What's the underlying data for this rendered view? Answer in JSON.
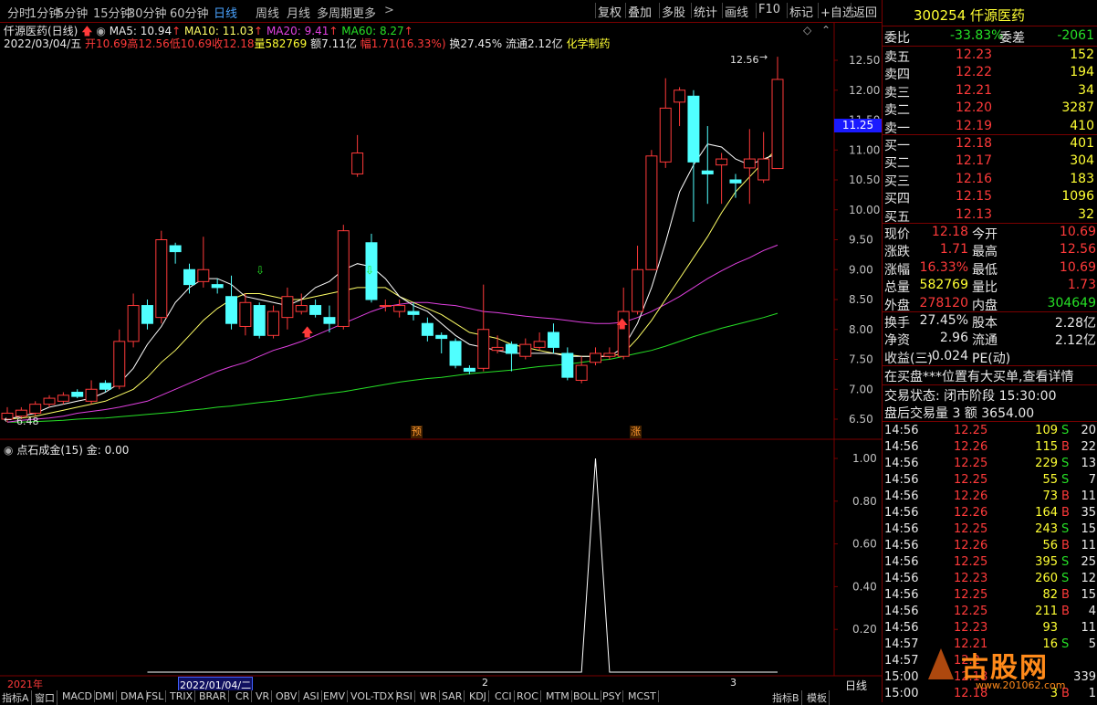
{
  "toolbar": {
    "periods": [
      "分时",
      "1分钟",
      "5分钟",
      "15分钟",
      "30分钟",
      "60分钟",
      "日线",
      "周线",
      "月线",
      "多周期",
      "更多"
    ],
    "active_period": "日线",
    "actions": [
      "复权",
      "叠加",
      "多股",
      "统计",
      "画线",
      "F10",
      "标记",
      "+自选",
      "返回"
    ]
  },
  "stock_line": {
    "name": "仟源医药(日线)",
    "ma5": "MA5: 10.94",
    "ma10": "MA10: 11.03",
    "ma20": "MA20: 9.41",
    "ma60": "MA60: 8.27",
    "date": "2022/03/04/五",
    "open": "开10.69",
    "high": "高12.56",
    "low": "低10.69",
    "close": "收12.18",
    "volume": "量582769",
    "amount": "额7.11亿",
    "range": "幅1.71(16.33%)",
    "turnover": "换27.45%",
    "float": "流通2.12亿",
    "industry": "化学制药"
  },
  "colors": {
    "up": "#ff3a3a",
    "down": "#50ffff",
    "ma5": "#ffffff",
    "ma10": "#ffff66",
    "ma20": "#e040e0",
    "ma60": "#26e026",
    "grid_border": "#7a0000"
  },
  "price_axis": {
    "labels": [
      "12.50",
      "12.00",
      "11.50",
      "11.00",
      "10.50",
      "10.00",
      "9.50",
      "9.00",
      "8.50",
      "8.00",
      "7.50",
      "7.00",
      "6.50"
    ],
    "current": "11.25",
    "high_mark": "12.56",
    "low_mark": "6.48"
  },
  "markers": {
    "yu": "预",
    "zhang": "涨"
  },
  "indicator": {
    "title": "点石成金(15)",
    "value": "金: 0.00",
    "labels": [
      "1.00",
      "0.80",
      "0.60",
      "0.40",
      "0.20"
    ],
    "axis_label": "日线"
  },
  "x_axis": {
    "labels": [
      "2021年",
      "2022/01/04/二",
      "2",
      "3"
    ]
  },
  "bottom_tabs": [
    "指标A",
    "窗口",
    "MACD",
    "DMI",
    "DMA",
    "FSL",
    "TRIX",
    "BRAR",
    "CR",
    "VR",
    "OBV",
    "ASI",
    "EMV",
    "VOL-TDX",
    "RSI",
    "WR",
    "SAR",
    "KDJ",
    "CCI",
    "ROC",
    "MTM",
    "BOLL",
    "PSY",
    "MCST",
    "指标B",
    "模板"
  ],
  "chart_data": {
    "type": "candlestick",
    "candles": [
      {
        "o": 6.5,
        "c": 6.6,
        "h": 6.7,
        "l": 6.45
      },
      {
        "o": 6.55,
        "c": 6.65,
        "h": 6.7,
        "l": 6.5
      },
      {
        "o": 6.6,
        "c": 6.75,
        "h": 6.8,
        "l": 6.55
      },
      {
        "o": 6.75,
        "c": 6.85,
        "h": 6.9,
        "l": 6.7
      },
      {
        "o": 6.8,
        "c": 6.9,
        "h": 6.95,
        "l": 6.75
      },
      {
        "o": 6.95,
        "c": 6.88,
        "h": 7.0,
        "l": 6.85
      },
      {
        "o": 6.8,
        "c": 7.0,
        "h": 7.15,
        "l": 6.75
      },
      {
        "o": 7.1,
        "c": 7.0,
        "h": 7.15,
        "l": 6.95
      },
      {
        "o": 7.05,
        "c": 7.8,
        "h": 8.0,
        "l": 7.0
      },
      {
        "o": 7.8,
        "c": 8.4,
        "h": 8.6,
        "l": 7.7
      },
      {
        "o": 8.4,
        "c": 8.1,
        "h": 8.5,
        "l": 8.0
      },
      {
        "o": 8.2,
        "c": 9.5,
        "h": 9.65,
        "l": 8.1
      },
      {
        "o": 9.4,
        "c": 9.3,
        "h": 9.45,
        "l": 9.1
      },
      {
        "o": 9.0,
        "c": 8.75,
        "h": 9.1,
        "l": 8.6
      },
      {
        "o": 8.8,
        "c": 9.0,
        "h": 9.55,
        "l": 8.7
      },
      {
        "o": 8.75,
        "c": 8.7,
        "h": 8.85,
        "l": 8.6
      },
      {
        "o": 8.55,
        "c": 8.1,
        "h": 8.9,
        "l": 8.0
      },
      {
        "o": 8.05,
        "c": 8.45,
        "h": 8.6,
        "l": 7.9
      },
      {
        "o": 8.4,
        "c": 7.9,
        "h": 8.45,
        "l": 7.85
      },
      {
        "o": 7.9,
        "c": 8.3,
        "h": 8.4,
        "l": 7.85
      },
      {
        "o": 8.2,
        "c": 8.55,
        "h": 8.7,
        "l": 8.0
      },
      {
        "o": 8.3,
        "c": 8.4,
        "h": 8.6,
        "l": 8.25
      },
      {
        "o": 8.4,
        "c": 8.25,
        "h": 8.5,
        "l": 8.2
      },
      {
        "o": 8.2,
        "c": 8.1,
        "h": 8.4,
        "l": 7.95
      },
      {
        "o": 8.05,
        "c": 9.65,
        "h": 9.75,
        "l": 8.0
      },
      {
        "o": 10.6,
        "c": 10.95,
        "h": 11.25,
        "l": 10.55
      },
      {
        "o": 9.45,
        "c": 8.5,
        "h": 9.6,
        "l": 8.45
      },
      {
        "o": 8.4,
        "c": 8.4,
        "h": 8.5,
        "l": 8.3
      },
      {
        "o": 8.3,
        "c": 8.4,
        "h": 8.5,
        "l": 8.2
      },
      {
        "o": 8.3,
        "c": 8.25,
        "h": 8.45,
        "l": 8.15
      },
      {
        "o": 8.1,
        "c": 7.9,
        "h": 8.2,
        "l": 7.8
      },
      {
        "o": 7.9,
        "c": 7.85,
        "h": 7.95,
        "l": 7.6
      },
      {
        "o": 7.8,
        "c": 7.4,
        "h": 7.85,
        "l": 7.35
      },
      {
        "o": 7.35,
        "c": 7.3,
        "h": 7.4,
        "l": 7.25
      },
      {
        "o": 7.35,
        "c": 8.0,
        "h": 8.75,
        "l": 7.3
      },
      {
        "o": 7.65,
        "c": 7.7,
        "h": 7.9,
        "l": 7.6
      },
      {
        "o": 7.75,
        "c": 7.6,
        "h": 7.8,
        "l": 7.3
      },
      {
        "o": 7.55,
        "c": 7.75,
        "h": 7.85,
        "l": 7.5
      },
      {
        "o": 7.7,
        "c": 7.8,
        "h": 7.95,
        "l": 7.65
      },
      {
        "o": 7.95,
        "c": 7.7,
        "h": 8.1,
        "l": 7.6
      },
      {
        "o": 7.6,
        "c": 7.2,
        "h": 7.7,
        "l": 7.15
      },
      {
        "o": 7.15,
        "c": 7.4,
        "h": 7.55,
        "l": 7.1
      },
      {
        "o": 7.45,
        "c": 7.6,
        "h": 7.7,
        "l": 7.4
      },
      {
        "o": 7.55,
        "c": 7.6,
        "h": 7.7,
        "l": 7.5
      },
      {
        "o": 7.55,
        "c": 8.3,
        "h": 8.7,
        "l": 7.5
      },
      {
        "o": 8.3,
        "c": 9.0,
        "h": 9.4,
        "l": 8.25
      },
      {
        "o": 9.0,
        "c": 10.9,
        "h": 11.0,
        "l": 9.5
      },
      {
        "o": 10.8,
        "c": 11.7,
        "h": 12.2,
        "l": 10.7
      },
      {
        "o": 11.8,
        "c": 12.0,
        "h": 12.05,
        "l": 11.4
      },
      {
        "o": 11.9,
        "c": 10.8,
        "h": 12.0,
        "l": 9.8
      },
      {
        "o": 10.65,
        "c": 10.6,
        "h": 11.4,
        "l": 10.1
      },
      {
        "o": 10.75,
        "c": 10.85,
        "h": 10.95,
        "l": 10.1
      },
      {
        "o": 10.5,
        "c": 10.45,
        "h": 10.6,
        "l": 10.2
      },
      {
        "o": 10.7,
        "c": 10.85,
        "h": 11.35,
        "l": 10.1
      },
      {
        "o": 10.5,
        "c": 10.85,
        "h": 11.3,
        "l": 10.45
      },
      {
        "o": 10.69,
        "c": 12.18,
        "h": 12.56,
        "l": 10.69
      }
    ],
    "ma5": [
      6.5,
      6.55,
      6.6,
      6.7,
      6.75,
      6.8,
      6.85,
      6.95,
      7.1,
      7.35,
      7.75,
      8.05,
      8.45,
      8.7,
      8.85,
      8.85,
      8.75,
      8.55,
      8.5,
      8.45,
      8.4,
      8.5,
      8.7,
      8.8,
      9.0,
      9.1,
      9.05,
      8.85,
      8.55,
      8.4,
      8.3,
      8.1,
      7.9,
      7.75,
      7.7,
      7.65,
      7.6,
      7.6,
      7.6,
      7.6,
      7.55,
      7.55,
      7.55,
      7.55,
      7.7,
      8.1,
      8.7,
      9.45,
      10.3,
      10.75,
      11.1,
      11.05,
      10.85,
      10.75,
      10.85,
      10.94
    ],
    "ma10": [
      6.5,
      6.52,
      6.55,
      6.6,
      6.65,
      6.7,
      6.75,
      6.8,
      6.9,
      7.0,
      7.2,
      7.45,
      7.65,
      7.9,
      8.15,
      8.35,
      8.5,
      8.6,
      8.6,
      8.55,
      8.5,
      8.5,
      8.55,
      8.6,
      8.65,
      8.7,
      8.7,
      8.7,
      8.55,
      8.45,
      8.35,
      8.25,
      8.1,
      7.95,
      7.9,
      7.85,
      7.75,
      7.7,
      7.65,
      7.6,
      7.58,
      7.55,
      7.55,
      7.55,
      7.6,
      7.85,
      8.15,
      8.5,
      8.85,
      9.2,
      9.55,
      9.95,
      10.3,
      10.55,
      10.8,
      11.03
    ],
    "ma20": [
      6.45,
      6.48,
      6.5,
      6.52,
      6.55,
      6.6,
      6.63,
      6.66,
      6.7,
      6.75,
      6.8,
      6.9,
      7.0,
      7.1,
      7.2,
      7.3,
      7.38,
      7.45,
      7.55,
      7.65,
      7.72,
      7.8,
      7.9,
      8.0,
      8.1,
      8.2,
      8.3,
      8.38,
      8.42,
      8.45,
      8.45,
      8.42,
      8.4,
      8.35,
      8.3,
      8.28,
      8.25,
      8.22,
      8.2,
      8.18,
      8.15,
      8.12,
      8.1,
      8.1,
      8.12,
      8.2,
      8.3,
      8.42,
      8.55,
      8.7,
      8.85,
      8.98,
      9.1,
      9.2,
      9.32,
      9.41
    ],
    "ma60": [
      6.45,
      6.45,
      6.46,
      6.47,
      6.48,
      6.5,
      6.51,
      6.52,
      6.54,
      6.56,
      6.58,
      6.6,
      6.62,
      6.65,
      6.67,
      6.7,
      6.72,
      6.75,
      6.78,
      6.8,
      6.83,
      6.86,
      6.9,
      6.93,
      6.96,
      7.0,
      7.04,
      7.08,
      7.12,
      7.15,
      7.18,
      7.2,
      7.23,
      7.26,
      7.28,
      7.3,
      7.32,
      7.35,
      7.38,
      7.4,
      7.42,
      7.45,
      7.48,
      7.5,
      7.55,
      7.6,
      7.65,
      7.72,
      7.8,
      7.88,
      7.95,
      8.02,
      8.08,
      8.14,
      8.2,
      8.27
    ],
    "indicator": [
      0,
      0,
      0,
      0,
      0,
      0,
      0,
      0,
      0,
      0,
      0,
      0,
      0,
      0,
      0,
      0,
      0,
      0,
      0,
      0,
      0,
      0,
      0,
      0,
      0,
      0,
      0,
      0,
      0,
      0,
      0,
      0,
      0,
      0,
      0,
      0,
      0,
      0,
      0,
      0,
      0,
      0,
      1,
      0,
      0,
      0,
      0,
      0,
      0,
      0,
      0,
      0,
      0,
      0,
      0,
      0
    ]
  },
  "quote": {
    "code": "300254",
    "name": "仟源医药",
    "weibi": {
      "label": "委比",
      "value": "-33.83%",
      "label2": "委差",
      "value2": "-2061"
    },
    "asks": [
      {
        "label": "卖五",
        "price": "12.23",
        "vol": "152"
      },
      {
        "label": "卖四",
        "price": "12.22",
        "vol": "194"
      },
      {
        "label": "卖三",
        "price": "12.21",
        "vol": "34"
      },
      {
        "label": "卖二",
        "price": "12.20",
        "vol": "3287"
      },
      {
        "label": "卖一",
        "price": "12.19",
        "vol": "410"
      }
    ],
    "bids": [
      {
        "label": "买一",
        "price": "12.18",
        "vol": "401"
      },
      {
        "label": "买二",
        "price": "12.17",
        "vol": "304"
      },
      {
        "label": "买三",
        "price": "12.16",
        "vol": "183"
      },
      {
        "label": "买四",
        "price": "12.15",
        "vol": "1096"
      },
      {
        "label": "买五",
        "price": "12.13",
        "vol": "32"
      }
    ],
    "stats1": [
      {
        "l1": "现价",
        "v1": "12.18",
        "l2": "今开",
        "v2": "10.69"
      },
      {
        "l1": "涨跌",
        "v1": "1.71",
        "l2": "最高",
        "v2": "12.56"
      },
      {
        "l1": "涨幅",
        "v1": "16.33%",
        "l2": "最低",
        "v2": "10.69"
      },
      {
        "l1": "总量",
        "v1": "582769",
        "l2": "量比",
        "v2": "1.73"
      },
      {
        "l1": "外盘",
        "v1": "278120",
        "l2": "内盘",
        "v2": "304649"
      }
    ],
    "stats2": [
      {
        "l1": "换手",
        "v1": "27.45%",
        "l2": "股本",
        "v2": "2.28亿"
      },
      {
        "l1": "净资",
        "v1": "2.96",
        "l2": "流通",
        "v2": "2.12亿"
      },
      {
        "l1": "收益(三)",
        "v1": "-0.024",
        "l2": "PE(动)",
        "v2": ""
      }
    ],
    "notice": "在买盘***位置有大买单,查看详情",
    "trade_status": "交易状态: 闭市阶段 15:30:00",
    "after_hours": "盘后交易量 3 额 3654.00"
  },
  "ticks": [
    {
      "t": "14:56",
      "p": "12.25",
      "v": "109",
      "s": "S",
      "n": "20"
    },
    {
      "t": "14:56",
      "p": "12.26",
      "v": "115",
      "s": "B",
      "n": "22"
    },
    {
      "t": "14:56",
      "p": "12.25",
      "v": "229",
      "s": "S",
      "n": "13"
    },
    {
      "t": "14:56",
      "p": "12.25",
      "v": "55",
      "s": "S",
      "n": "7"
    },
    {
      "t": "14:56",
      "p": "12.26",
      "v": "73",
      "s": "B",
      "n": "11"
    },
    {
      "t": "14:56",
      "p": "12.26",
      "v": "164",
      "s": "B",
      "n": "35"
    },
    {
      "t": "14:56",
      "p": "12.25",
      "v": "243",
      "s": "S",
      "n": "15"
    },
    {
      "t": "14:56",
      "p": "12.26",
      "v": "56",
      "s": "B",
      "n": "11"
    },
    {
      "t": "14:56",
      "p": "12.25",
      "v": "395",
      "s": "S",
      "n": "25"
    },
    {
      "t": "14:56",
      "p": "12.23",
      "v": "260",
      "s": "S",
      "n": "12"
    },
    {
      "t": "14:56",
      "p": "12.25",
      "v": "82",
      "s": "B",
      "n": "15"
    },
    {
      "t": "14:56",
      "p": "12.25",
      "v": "211",
      "s": "B",
      "n": "4"
    },
    {
      "t": "14:56",
      "p": "12.23",
      "v": "93",
      "s": "",
      "n": "11"
    },
    {
      "t": "14:57",
      "p": "12.21",
      "v": "16",
      "s": "S",
      "n": "5"
    },
    {
      "t": "14:57",
      "p": "12.2",
      "v": "",
      "s": "",
      "n": ""
    },
    {
      "t": "15:00",
      "p": "12.18",
      "v": "",
      "s": "",
      "n": "339"
    },
    {
      "t": "15:00",
      "p": "12.18",
      "v": "3",
      "s": "B",
      "n": "1"
    }
  ],
  "watermark": {
    "brand": "古股网",
    "url": "www.201062.com"
  }
}
